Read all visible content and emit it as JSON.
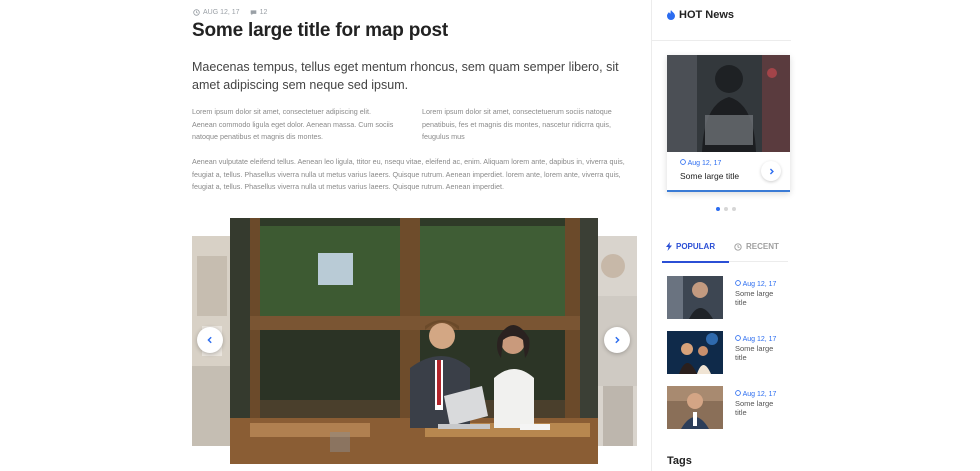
{
  "article": {
    "date": "AUG 12, 17",
    "comments": "12",
    "title": "Some large title for map post",
    "lead": "Maecenas tempus, tellus eget mentum rhoncus, sem quam semper libero, sit amet adipiscing sem neque sed ipsum.",
    "col_left": "Lorem ipsum dolor sit amet, consectetuer adipiscing elit. Aenean commodo ligula eget dolor. Aenean massa. Cum sociis natoque penatibus et magnis dis montes.",
    "col_right": "Lorem ipsum dolor sit amet, consectetuerum sociis natoque penatibuis, fes et magnis dis montes, nascetur ridicrra quis, feugulus mus",
    "paragraph": "Aenean vulputate eleifend tellus. Aenean leo ligula, ttitor eu, nsequ vitae, eleifend ac, enim. Aliquam lorem ante, dapibus in, viverra quis, feugiat a, tellus. Phasellus viverra nulla ut metus varius laeers. Quisque rutrum. Aenean imperdiet. lorem ante, lorem ante, viverra quis, feugiat a, tellus. Phasellus viverra nulla ut metus varius laeers. Quisque rutrum. Aenean imperdiet."
  },
  "carousel": {
    "prev_icon": "chevron-left-icon",
    "next_icon": "chevron-right-icon"
  },
  "hot_news": {
    "title": "HOT News",
    "icon": "flame-icon",
    "card": {
      "date": "Aug 12, 17",
      "title": "Some large title"
    },
    "dots": 3,
    "active_dot": 0
  },
  "tabs": {
    "popular": "POPULAR",
    "recent": "RECENT"
  },
  "posts": [
    {
      "date": "Aug 12, 17",
      "title": "Some large title"
    },
    {
      "date": "Aug 12, 17",
      "title": "Some large title"
    },
    {
      "date": "Aug 12, 17",
      "title": "Some large title"
    }
  ],
  "tags_title": "Tags",
  "colors": {
    "accent": "#2b6cf0",
    "tab_active": "#2b4fd5"
  }
}
